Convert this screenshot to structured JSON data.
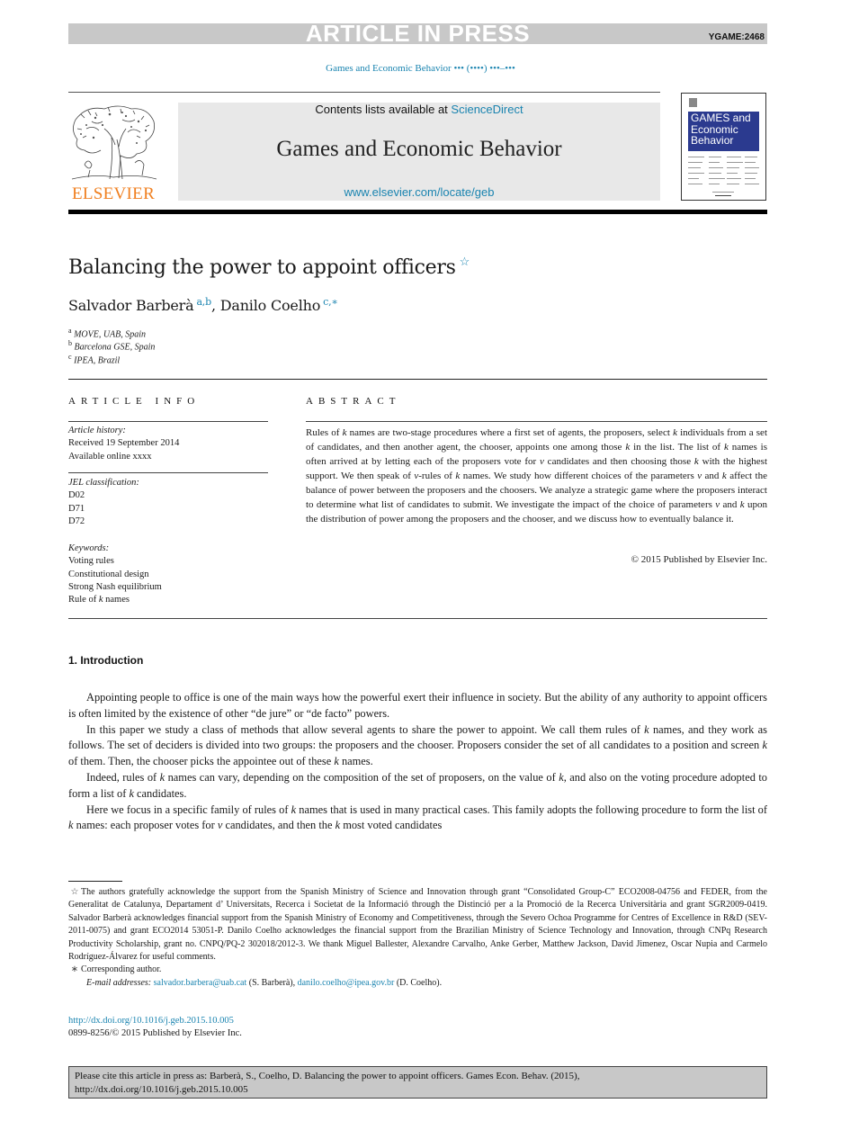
{
  "banner": {
    "status": "ARTICLE IN PRESS",
    "manuscript_code": "YGAME:2468",
    "journal_ref": "Games and Economic Behavior ••• (••••) •••–•••"
  },
  "masthead": {
    "publisher_logo_text": "ELSEVIER",
    "contents_prefix": "Contents lists available at ",
    "contents_link": "ScienceDirect",
    "journal_name": "Games and Economic Behavior",
    "journal_url": "www.elsevier.com/locate/geb",
    "cover_title_lines": [
      "GAMES and",
      "Economic",
      "Behavior"
    ]
  },
  "article": {
    "title": "Balancing the power to appoint officers",
    "title_note_mark": "☆",
    "authors": [
      {
        "name": "Salvador Barberà",
        "marks": "a,b"
      },
      {
        "name": "Danilo Coelho",
        "marks": "c,∗"
      }
    ],
    "affiliations": [
      {
        "mark": "a",
        "text": "MOVE, UAB, Spain"
      },
      {
        "mark": "b",
        "text": "Barcelona GSE, Spain"
      },
      {
        "mark": "c",
        "text": "IPEA, Brazil"
      }
    ]
  },
  "article_info": {
    "heading": "ARTICLE INFO",
    "history_label": "Article history:",
    "history": [
      "Received 19 September 2014",
      "Available online xxxx"
    ],
    "jel_label": "JEL classification:",
    "jel": [
      "D02",
      "D71",
      "D72"
    ],
    "keywords_label": "Keywords:",
    "keywords": [
      "Voting rules",
      "Constitutional design",
      "Strong Nash equilibrium",
      "Rule of k names"
    ]
  },
  "abstract": {
    "heading": "ABSTRACT",
    "body": "Rules of k names are two-stage procedures where a first set of agents, the proposers, select k individuals from a set of candidates, and then another agent, the chooser, appoints one among those k in the list. The list of k names is often arrived at by letting each of the proposers vote for v candidates and then choosing those k with the highest support. We then speak of v-rules of k names. We study how different choices of the parameters v and k affect the balance of power between the proposers and the choosers. We analyze a strategic game where the proposers interact to determine what list of candidates to submit. We investigate the impact of the choice of parameters v and k upon the distribution of power among the proposers and the chooser, and we discuss how to eventually balance it.",
    "copyright": "© 2015 Published by Elsevier Inc."
  },
  "introduction": {
    "heading": "1. Introduction",
    "paragraphs": [
      "Appointing people to office is one of the main ways how the powerful exert their influence in society. But the ability of any authority to appoint officers is often limited by the existence of other “de jure” or “de facto” powers.",
      "In this paper we study a class of methods that allow several agents to share the power to appoint. We call them rules of k names, and they work as follows. The set of deciders is divided into two groups: the proposers and the chooser. Proposers consider the set of all candidates to a position and screen k of them. Then, the chooser picks the appointee out of these k names.",
      "Indeed, rules of k names can vary, depending on the composition of the set of proposers, on the value of k, and also on the voting procedure adopted to form a list of k candidates.",
      "Here we focus in a specific family of rules of k names that is used in many practical cases. This family adopts the following procedure to form the list of k names: each proposer votes for v candidates, and then the k most voted candidates"
    ]
  },
  "footnotes": {
    "acknowledgement_mark": "☆",
    "acknowledgement": "The authors gratefully acknowledge the support from the Spanish Ministry of Science and Innovation through grant “Consolidated Group-C” ECO2008-04756 and FEDER, from the Generalitat de Catalunya, Departament d’ Universitats, Recerca i Societat de la Informació through the Distinció per a la Promoció de la Recerca Universitària and grant SGR2009-0419. Salvador Barberà acknowledges financial support from the Spanish Ministry of Economy and Competitiveness, through the Severo Ochoa Programme for Centres of Excellence in R&D (SEV-2011-0075) and grant ECO2014 53051-P. Danilo Coelho acknowledges the financial support from the Brazilian Ministry of Science Technology and Innovation, through CNPq Research Productivity Scholarship, grant no. CNPQ/PQ-2 302018/2012-3. We thank Miguel Ballester, Alexandre Carvalho, Anke Gerber, Matthew Jackson, David Jimenez, Oscar Nupia and Carmelo Rodríguez-Álvarez for useful comments.",
    "corresponding_mark": "∗",
    "corresponding": "Corresponding author.",
    "email_label": "E-mail addresses:",
    "emails": [
      {
        "address": "salvador.barbera@uab.cat",
        "who": "(S. Barberà),"
      },
      {
        "address": "danilo.coelho@ipea.gov.br",
        "who": "(D. Coelho)."
      }
    ]
  },
  "publication": {
    "doi": "http://dx.doi.org/10.1016/j.geb.2015.10.005",
    "issn_line": "0899-8256/© 2015 Published by Elsevier Inc."
  },
  "citation_box": {
    "line1": "Please cite this article in press as: Barberà, S., Coelho, D. Balancing the power to appoint officers. Games Econ. Behav. (2015),",
    "line2": "http://dx.doi.org/10.1016/j.geb.2015.10.005"
  }
}
